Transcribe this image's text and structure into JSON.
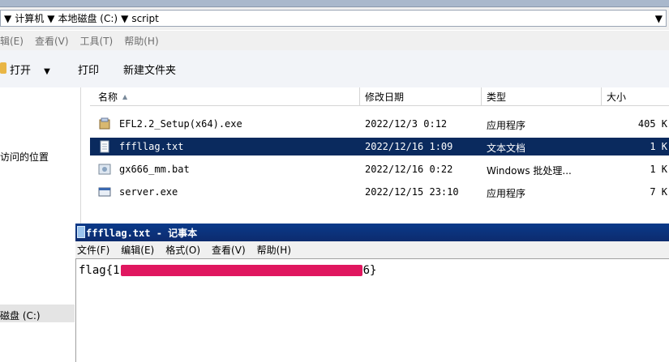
{
  "address_bar": {
    "crumbs": [
      "计算机",
      "本地磁盘 (C:)",
      "script"
    ]
  },
  "menubar": [
    "辑(E)",
    "查看(V)",
    "工具(T)",
    "帮助(H)"
  ],
  "toolbar": {
    "open": "打开",
    "print": "打印",
    "new_folder": "新建文件夹"
  },
  "nav": {
    "recent": "访问的位置",
    "disk": "磁盘 (C:)"
  },
  "columns": {
    "name": "名称",
    "date": "修改日期",
    "type": "类型",
    "size": "大小"
  },
  "files": [
    {
      "name": "EFL2.2_Setup(x64).exe",
      "date": "2022/12/3 0:12",
      "type": "应用程序",
      "size": "405 K",
      "icon": "installer-icon",
      "selected": false
    },
    {
      "name": "fffllag.txt",
      "date": "2022/12/16 1:09",
      "type": "文本文档",
      "size": "1 K",
      "icon": "text-file-icon",
      "selected": true
    },
    {
      "name": "gx666_mm.bat",
      "date": "2022/12/16 0:22",
      "type": "Windows 批处理...",
      "size": "1 K",
      "icon": "batch-file-icon",
      "selected": false
    },
    {
      "name": "server.exe",
      "date": "2022/12/15 23:10",
      "type": "应用程序",
      "size": "7 K",
      "icon": "exe-file-icon",
      "selected": false
    }
  ],
  "notepad": {
    "title": "fffllag.txt - 记事本",
    "menus": [
      "文件(F)",
      "编辑(E)",
      "格式(O)",
      "查看(V)",
      "帮助(H)"
    ],
    "text_prefix": "flag{1",
    "text_suffix": "6}"
  },
  "colors": {
    "selection": "#0a2a5e",
    "redaction": "#e0175f",
    "titlebar": "#0a3a8a"
  }
}
